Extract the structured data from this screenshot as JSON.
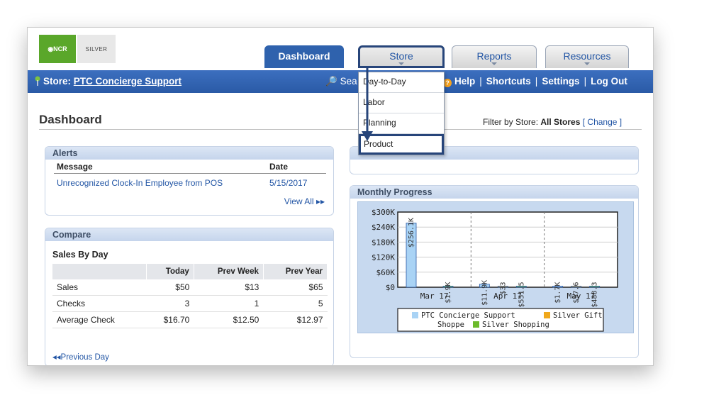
{
  "brand": {
    "ncr": "NCR",
    "silver": "SILVER"
  },
  "tabs": [
    {
      "label": "Dashboard"
    },
    {
      "label": "Store"
    },
    {
      "label": "Reports"
    },
    {
      "label": "Resources"
    }
  ],
  "navbar": {
    "store_prefix": "Store:",
    "store_name": "PTC Concierge Support",
    "search_fragment": "Sea",
    "help": "Help",
    "shortcuts": "Shortcuts",
    "settings": "Settings",
    "logout": "Log Out"
  },
  "store_menu": [
    "Day-to-Day",
    "Labor",
    "Planning",
    "Product"
  ],
  "page": {
    "title": "Dashboard",
    "filter_prefix": "Filter by Store:",
    "filter_value": "All Stores",
    "filter_change": "Change"
  },
  "alerts": {
    "title": "Alerts",
    "col_message": "Message",
    "col_date": "Date",
    "rows": [
      {
        "message": "Unrecognized Clock-In Employee from POS",
        "date": "5/15/2017"
      }
    ],
    "view_all": "View All"
  },
  "compare": {
    "title": "Compare",
    "subtitle": "Sales By Day",
    "headers": [
      "",
      "Today",
      "Prev Week",
      "Prev Year"
    ],
    "rows": [
      [
        "Sales",
        "$50",
        "$13",
        "$65"
      ],
      [
        "Checks",
        "3",
        "1",
        "5"
      ],
      [
        "Average Check",
        "$16.70",
        "$12.50",
        "$12.97"
      ]
    ],
    "prev_day": "Previous Day"
  },
  "monthly": {
    "title": "Monthly Progress"
  },
  "colors": {
    "series1": "#a9d3f5",
    "series2": "#f0a81c",
    "series3": "#6cba2b",
    "accent": "#2f62ad"
  },
  "chart_data": {
    "type": "bar",
    "categories": [
      "Mar 17",
      "Apr 17",
      "May 17"
    ],
    "series": [
      {
        "name": "PTC Concierge Support",
        "values": [
          256.1,
          11.9,
          1.7
        ],
        "labels": [
          "$256.1K",
          "$11.9K",
          "$1.7K"
        ]
      },
      {
        "name": "Silver Gift Shoppe",
        "values": [
          0,
          0.033,
          0.0976
        ],
        "labels": [
          "",
          "$33",
          "$97.6"
        ]
      },
      {
        "name": "Silver Shopping",
        "values": [
          1.9,
          0.5515,
          0.4883
        ],
        "labels": [
          "$1.9K",
          "$551.5",
          "$488.3"
        ]
      }
    ],
    "yticks": [
      "$0",
      "$60K",
      "$120K",
      "$180K",
      "$240K",
      "$300K"
    ],
    "ylim": [
      0,
      300
    ],
    "legend": [
      "PTC Concierge Support",
      "Silver Gift",
      "Shoppe",
      "Silver Shopping"
    ]
  }
}
